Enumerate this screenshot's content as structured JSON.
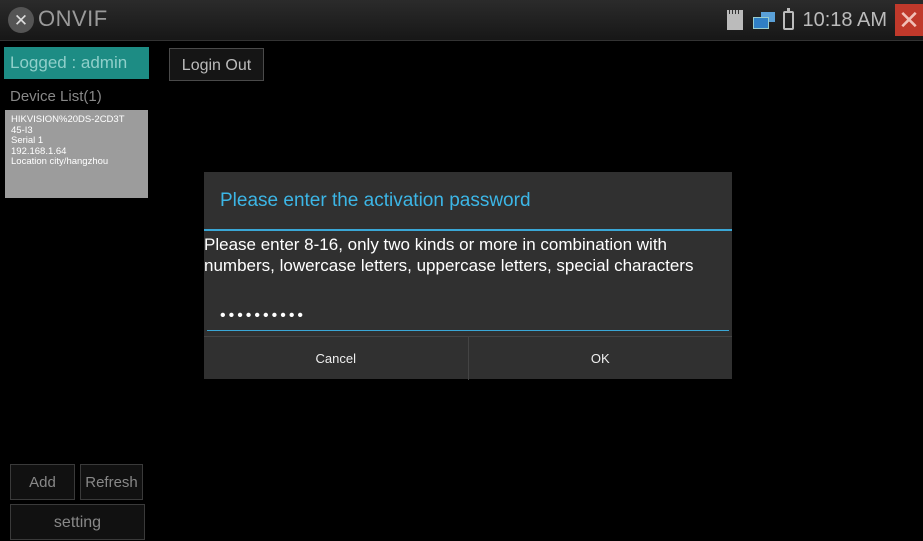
{
  "header": {
    "app_title": "ONVIF",
    "clock": "10:18 AM",
    "icons": [
      "onvif-logo-icon",
      "sd-card-icon",
      "network-icon",
      "battery-icon",
      "close-icon"
    ],
    "colors": {
      "close": "#c0392b",
      "accent": "#1d8c84"
    }
  },
  "sidebar": {
    "logged": "Logged : admin",
    "device_list_label": "Device List(1)",
    "device": {
      "line1": "HIKVISION%20DS-2CD3T",
      "line2": "45-I3",
      "line3": "Serial 1",
      "line4": "192.168.1.64",
      "line5": "Location city/hangzhou"
    },
    "add_label": "Add",
    "refresh_label": "Refresh",
    "setting_label": "setting"
  },
  "main": {
    "logout_label": "Login Out"
  },
  "dialog": {
    "title": "Please enter the activation password",
    "message": "Please enter 8-16, only two kinds or more in combination with numbers, lowercase letters, uppercase letters, special characters",
    "password_masked": "••••••••••",
    "cancel_label": "Cancel",
    "ok_label": "OK"
  }
}
